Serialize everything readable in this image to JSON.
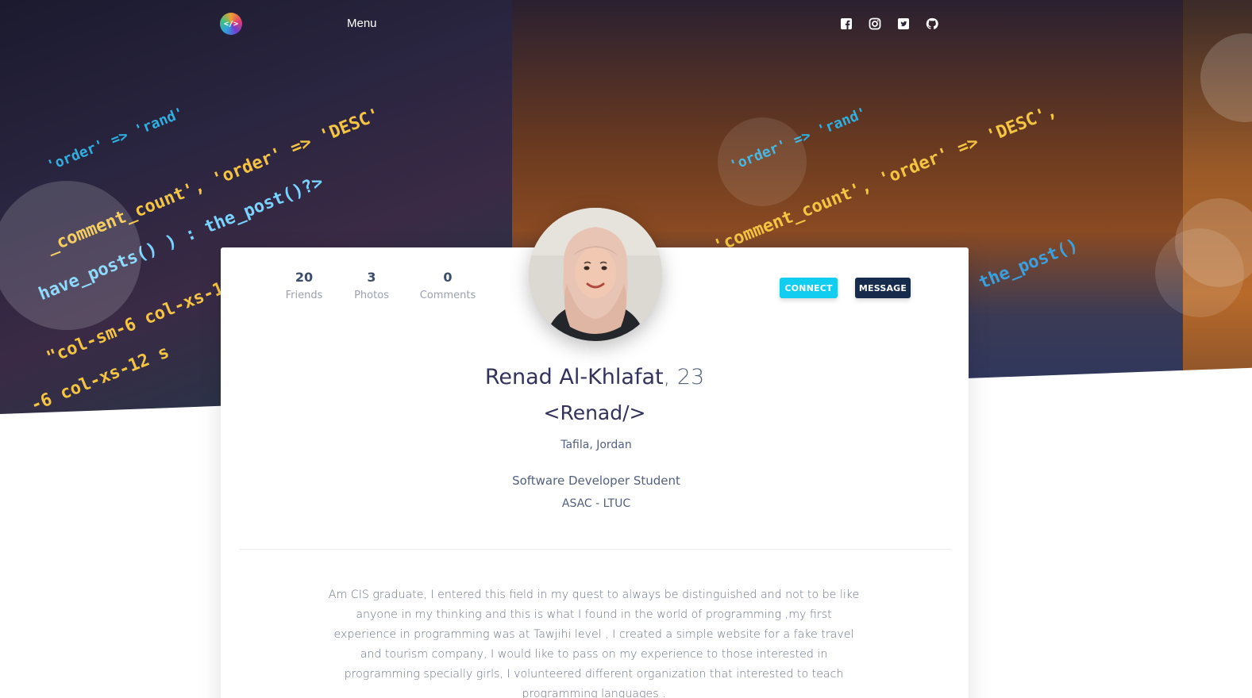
{
  "nav": {
    "logo_text": "</>",
    "menu_label": "Menu",
    "social": [
      "facebook-icon",
      "instagram-icon",
      "twitter-icon",
      "github-icon"
    ]
  },
  "stats": [
    {
      "value": "20",
      "label": "Friends"
    },
    {
      "value": "3",
      "label": "Photos"
    },
    {
      "value": "0",
      "label": "Comments"
    }
  ],
  "actions": {
    "connect_label": "CONNECT",
    "message_label": "MESSAGE"
  },
  "profile": {
    "name": "Renad Al-Khlafat",
    "age": ", 23",
    "handle": "<Renad/>",
    "location": "Tafila, Jordan",
    "job_title": "Software Developer Student",
    "organization": "ASAC - LTUC",
    "bio": "Am CIS graduate, I entered this field in my quest to always be distinguished and not to be like anyone in my thinking and this is what I found in the world of programming ,my first experience in programming was at Tawjihi level , I created a simple website for a fake travel and tourism company, I would like to pass on my experience to those interested in programming specially girls, I volunteered different organization that interested to teach programming languages ."
  },
  "colors": {
    "connect": "#11cdef",
    "message": "#172b4d",
    "text_dark": "#32325d"
  }
}
